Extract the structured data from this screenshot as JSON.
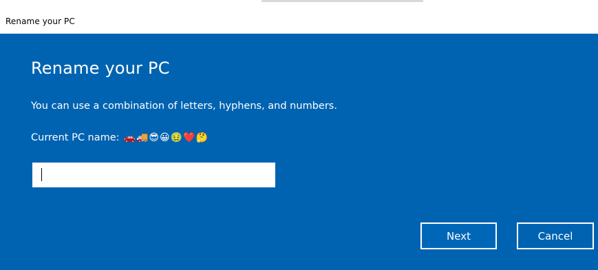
{
  "window": {
    "title": "Rename your PC"
  },
  "dialog": {
    "heading": "Rename your PC",
    "description": "You can use a combination of letters, hyphens, and numbers.",
    "current_label": "Current PC name:",
    "current_value": "🚗🚚😎😀🤢❤️🤔",
    "name_input": {
      "value": "",
      "placeholder": ""
    }
  },
  "buttons": {
    "next": "Next",
    "cancel": "Cancel"
  },
  "colors": {
    "accent": "#0063b1",
    "text": "#ffffff",
    "input_bg": "#ffffff"
  }
}
